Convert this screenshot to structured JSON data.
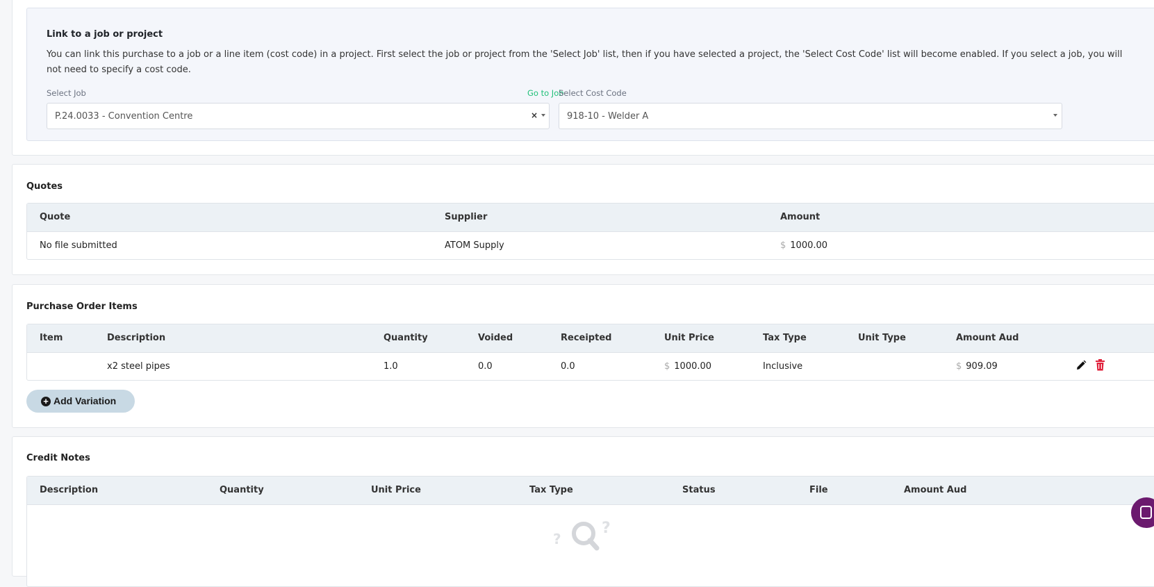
{
  "link_section": {
    "title": "Link to a job or project",
    "description": "You can link this purchase to a job or a line item (cost code) in a project. First select the job or project from the 'Select Job' list, then if you have selected a project, the 'Select Cost Code' list will become enabled. If you select a job, you will not need to specify a cost code.",
    "job_label": "Select Job",
    "goto_job": "Go to Job",
    "job_value": "P.24.0033 - Convention Centre",
    "cost_code_label": "Select Cost Code",
    "cost_code_value": "918-10 - Welder A",
    "clear_symbol": "×"
  },
  "quotes": {
    "title": "Quotes",
    "headers": [
      "Quote",
      "Supplier",
      "Amount"
    ],
    "rows": [
      {
        "quote": "No file submitted",
        "supplier": "ATOM Supply",
        "currency": "$",
        "amount": "1000.00"
      }
    ]
  },
  "purchase_order_items": {
    "title": "Purchase Order Items",
    "headers": [
      "Item",
      "Description",
      "Quantity",
      "Voided",
      "Receipted",
      "Unit Price",
      "Tax Type",
      "Unit Type",
      "Amount Aud"
    ],
    "rows": [
      {
        "item": "",
        "description": "x2 steel pipes",
        "quantity": "1.0",
        "voided": "0.0",
        "receipted": "0.0",
        "unit_currency": "$",
        "unit_price": "1000.00",
        "tax_type": "Inclusive",
        "unit_type": "",
        "amount_currency": "$",
        "amount": "909.09"
      }
    ],
    "add_variation_label": "Add Variation",
    "icons": {
      "edit": "pencil-icon",
      "delete": "trash-icon",
      "add": "plus-circle-icon"
    },
    "delete_color": "#e0203a"
  },
  "credit_notes": {
    "title": "Credit Notes",
    "headers": [
      "Description",
      "Quantity",
      "Unit Price",
      "Tax Type",
      "Status",
      "File",
      "Amount Aud"
    ],
    "empty_icon": "empty-search-icon"
  },
  "chat": {
    "icon": "chat-icon",
    "color": "#6b1a6e"
  },
  "colors": {
    "accent_green": "#22c07a",
    "header_bg": "#ecf1f5",
    "button_bg": "#c8d9e4"
  }
}
